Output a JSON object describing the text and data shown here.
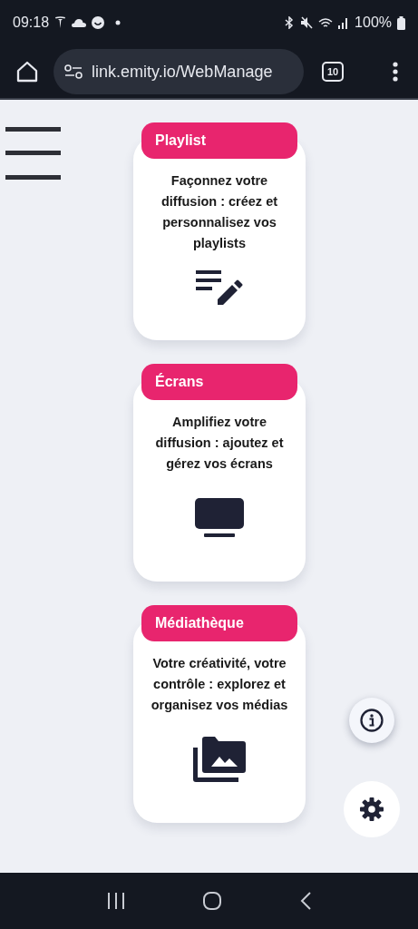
{
  "status_bar": {
    "time": "09:18",
    "battery": "100%"
  },
  "browser": {
    "url": "link.emity.io/WebManage",
    "tab_count": "10"
  },
  "cards": [
    {
      "title": "Playlist",
      "description": "Façonnez votre diffusion : créez et personnalisez vos playlists",
      "kind": "playlist"
    },
    {
      "title": "Écrans",
      "description": "Amplifiez votre diffusion : ajoutez et gérez vos écrans",
      "kind": "screen"
    },
    {
      "title": "Médiathèque",
      "description": "Votre créativité, votre contrôle : explorez et organisez vos médias",
      "kind": "media"
    }
  ]
}
